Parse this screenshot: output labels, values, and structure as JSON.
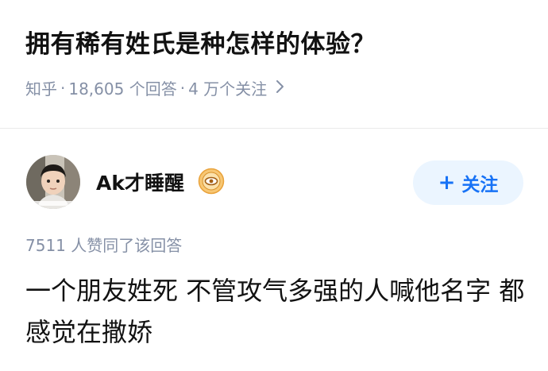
{
  "question": {
    "title": "拥有稀有姓氏是种怎样的体验？",
    "source": "知乎",
    "separator": "·",
    "answers_count": "18,605 个回答",
    "followers": "4 万个关注",
    "chevron_icon": "chevron-right-icon"
  },
  "answer": {
    "author_name": "Ak才睡醒",
    "avatar_icon": "avatar",
    "badge_icon": "eye-badge-icon",
    "follow_label": "关注",
    "follow_plus": "+",
    "vote_text": "7511 人赞同了该回答",
    "content": "一个朋友姓死 不管攻气多强的人喊他名字 都感觉在撒娇"
  },
  "colors": {
    "accent": "#1772f6",
    "accent_bg": "#ebf5ff",
    "meta_gray": "#8590a6",
    "badge_orange": "#f2a33a"
  }
}
